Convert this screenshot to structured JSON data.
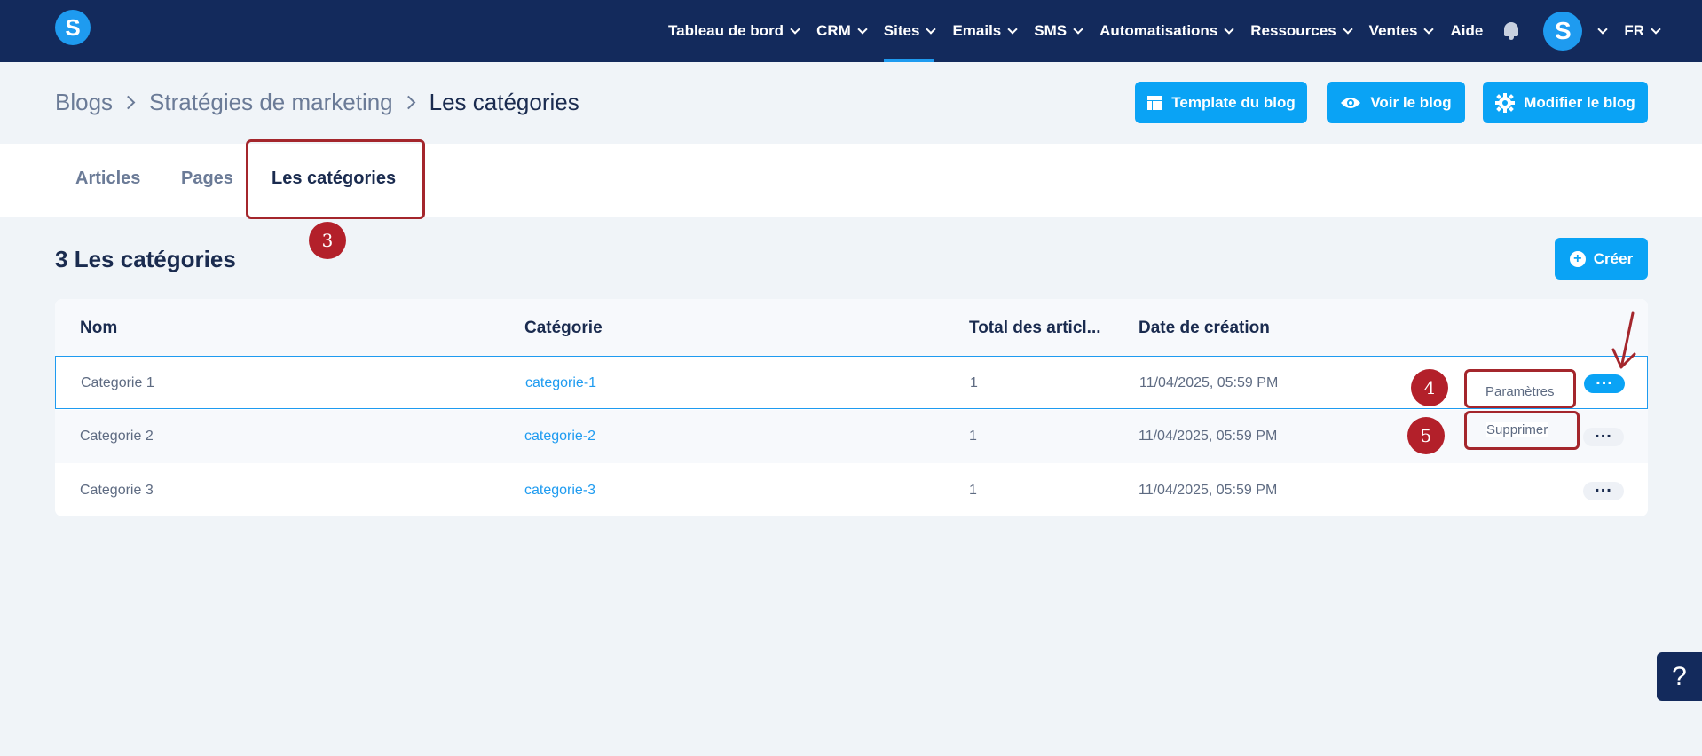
{
  "app": {
    "logo_letter": "S",
    "brand_color": "#1e9bf0",
    "nav_color": "#132a5c"
  },
  "nav": {
    "items": [
      {
        "label": "Tableau de bord",
        "has_menu": true
      },
      {
        "label": "CRM",
        "has_menu": true
      },
      {
        "label": "Sites",
        "has_menu": true,
        "active": true
      },
      {
        "label": "Emails",
        "has_menu": true
      },
      {
        "label": "SMS",
        "has_menu": true
      },
      {
        "label": "Automatisations",
        "has_menu": true
      },
      {
        "label": "Ressources",
        "has_menu": true
      },
      {
        "label": "Ventes",
        "has_menu": true
      },
      {
        "label": "Aide",
        "has_menu": false
      }
    ],
    "avatar_letter": "S",
    "language": "FR"
  },
  "breadcrumb": {
    "items": [
      "Blogs",
      "Stratégies de marketing",
      "Les catégories"
    ]
  },
  "actions": {
    "template": "Template du blog",
    "view": "Voir le blog",
    "edit": "Modifier le blog"
  },
  "tabs": [
    {
      "label": "Articles"
    },
    {
      "label": "Pages"
    },
    {
      "label": "Les catégories",
      "active": true
    }
  ],
  "section": {
    "count": "3",
    "title": "Les catégories",
    "create_label": "Créer"
  },
  "table": {
    "columns": [
      "Nom",
      "Catégorie",
      "Total des articl...",
      "Date de création"
    ],
    "rows": [
      {
        "name": "Categorie 1",
        "slug": "categorie-1",
        "total": "1",
        "date": "11/04/2025, 05:59 PM",
        "selected": true
      },
      {
        "name": "Categorie 2",
        "slug": "categorie-2",
        "total": "1",
        "date": "11/04/2025, 05:59 PM"
      },
      {
        "name": "Categorie 3",
        "slug": "categorie-3",
        "total": "1",
        "date": "11/04/2025, 05:59 PM"
      }
    ],
    "row_menu": {
      "settings": "Paramètres",
      "delete": "Supprimer"
    }
  },
  "annotations": {
    "step3": "3",
    "step4": "4",
    "step5": "5",
    "color": "#a4262c"
  },
  "help": {
    "label": "?"
  }
}
